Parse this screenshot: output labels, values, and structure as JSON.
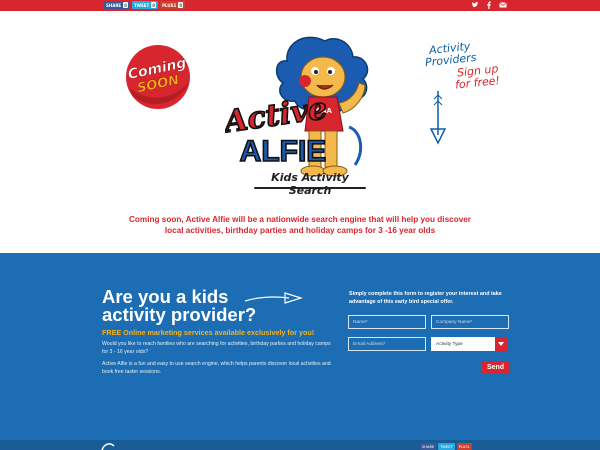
{
  "topbar": {
    "share": [
      {
        "label": "SHARE",
        "icon": "facebook-icon",
        "count": "0",
        "color": "#3b5998"
      },
      {
        "label": "TWEET",
        "icon": "twitter-icon",
        "count": "0",
        "color": "#2aa9e0"
      },
      {
        "label": "PLUS1",
        "icon": "google-plus-icon",
        "count": "0",
        "color": "#c94130"
      }
    ],
    "social_icons": [
      "twitter-icon",
      "facebook-icon",
      "email-icon"
    ]
  },
  "hero": {
    "badge": {
      "line1": "Coming",
      "line2": "SOON"
    },
    "logo": {
      "line1": "Active",
      "line2": "ALFIE"
    },
    "shirt_text": "CAA",
    "tagline": "Kids Activity Search",
    "providers": {
      "line1": "Activity",
      "line2": "Providers",
      "line3": "Sign up",
      "line4": "for free!"
    },
    "intro": "Coming soon, Active Alfie will be a nationwide search engine that will help you discover local activities, birthday parties and holiday camps for 3 -16 year olds"
  },
  "provider_section": {
    "heading_line1": "Are you a kids",
    "heading_line2": "activity provider?",
    "free_offer": "FREE Online marketing services available exclusively for you!",
    "para1": "Would you like to reach families who are searching for activities, birthday parties and holiday camps for 3 - 16 year olds?",
    "para2": "Active Alfie is a fun and easy to use search engine, which helps parents discover local activities and book free taster sessions."
  },
  "form": {
    "intro": "Simply complete this form to register your interest and take advantage of this early bird special offer.",
    "name_placeholder": "Name*",
    "company_placeholder": "Company Name*",
    "email_placeholder": "Email Address*",
    "activity_type": "Activity Type",
    "send_label": "Send"
  },
  "colors": {
    "red": "#d8262e",
    "blue": "#1c6db3",
    "dark_blue": "#185b95",
    "orange": "#f6b21a"
  }
}
